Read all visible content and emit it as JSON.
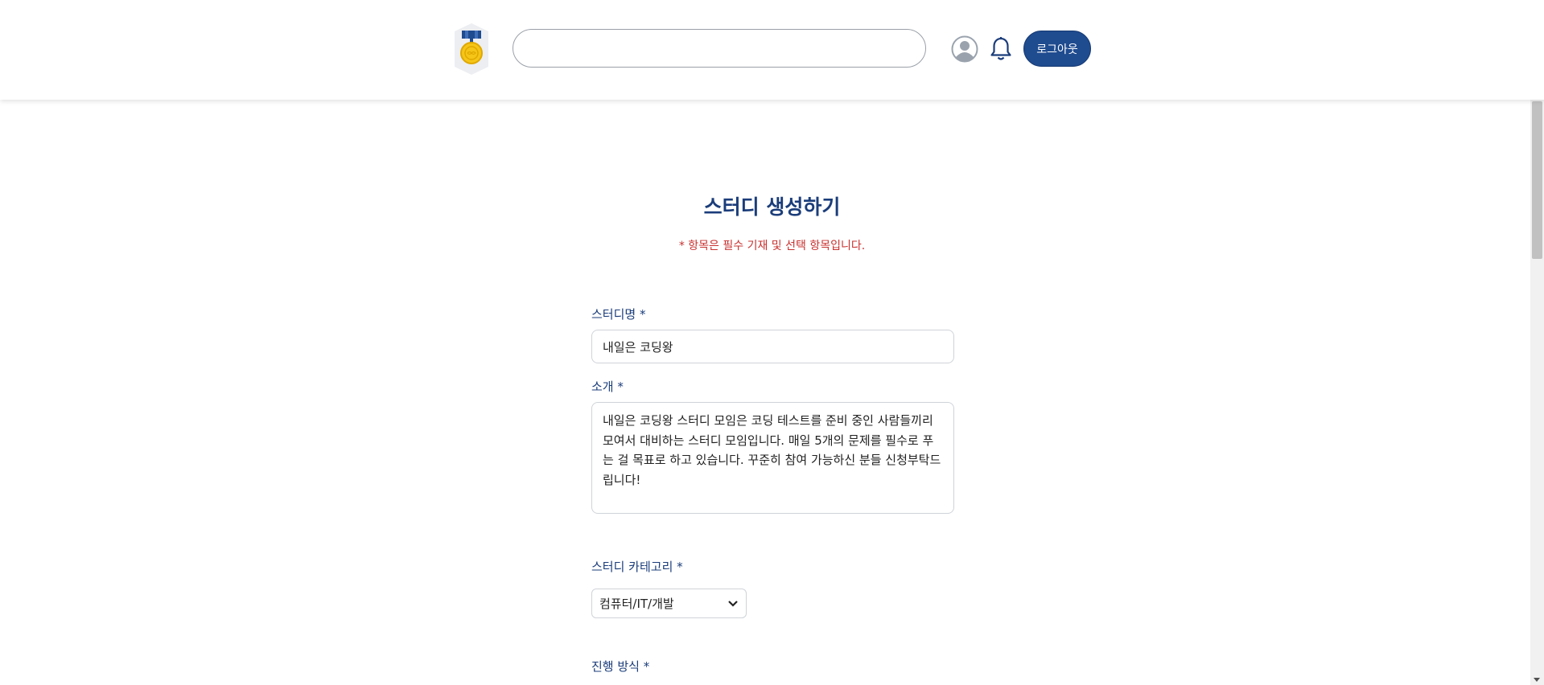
{
  "header": {
    "logo_alt": "medal-logo",
    "search": {
      "value": "",
      "placeholder": ""
    },
    "logout_label": "로그아웃"
  },
  "page": {
    "title": "스터디 생성하기",
    "required_note": "* 항목은 필수 기재 및 선택 항목입니다."
  },
  "form": {
    "name_label": "스터디명 *",
    "name_value": "내일은 코딩왕",
    "intro_label": "소개 *",
    "intro_value": "내일은 코딩왕 스터디 모임은 코딩 테스트를 준비 중인 사람들끼리 모여서 대비하는 스터디 모임입니다. 매일 5개의 문제를 필수로 푸는 걸 목표로 하고 있습니다. 꾸준히 참여 가능하신 분들 신청부탁드립니다!",
    "category_label": "스터디 카테고리 *",
    "category_value": "컴퓨터/IT/개발",
    "method_label": "진행 방식 *"
  },
  "colors": {
    "primary": "#1f4b8f",
    "title": "#1b3d7a",
    "required": "#c8312f",
    "medal_gold": "#f5c518",
    "ribbon_blue": "#1f4b8f"
  },
  "icons": [
    "medal-logo-icon",
    "user-avatar-icon",
    "bell-icon",
    "chevron-down-icon"
  ]
}
